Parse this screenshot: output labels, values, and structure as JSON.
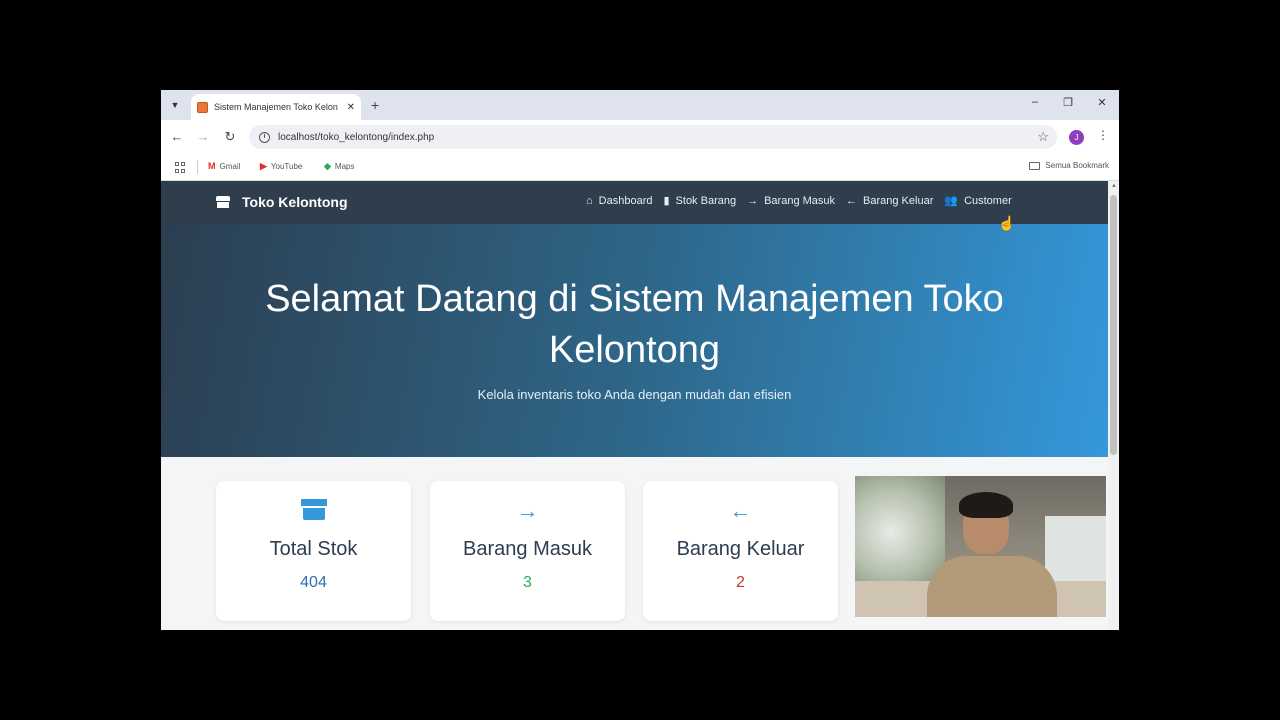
{
  "browser": {
    "tab_title": "Sistem Manajemen Toko Kelon",
    "url": "localhost/toko_kelontong/index.php",
    "profile_initial": "J",
    "bookmarks": [
      {
        "label": "Gmail",
        "icon": "gmail-icon",
        "icon_glyph": "M",
        "color": "#d93025"
      },
      {
        "label": "YouTube",
        "icon": "youtube-icon",
        "icon_glyph": "▶",
        "color": "#e52d27"
      },
      {
        "label": "Maps",
        "icon": "maps-icon",
        "icon_glyph": "◆",
        "color": "#34a853"
      }
    ],
    "all_bookmarks_label": "Semua Bookmark"
  },
  "navbar": {
    "brand": "Toko Kelontong",
    "links": [
      {
        "label": "Dashboard",
        "icon": "home-icon",
        "glyph": "⌂"
      },
      {
        "label": "Stok Barang",
        "icon": "box-icon",
        "glyph": "▮"
      },
      {
        "label": "Barang Masuk",
        "icon": "arrow-right-icon",
        "glyph": "→"
      },
      {
        "label": "Barang Keluar",
        "icon": "arrow-left-icon",
        "glyph": "←"
      },
      {
        "label": "Customer",
        "icon": "users-icon",
        "glyph": "👥"
      }
    ]
  },
  "hero": {
    "title": "Selamat Datang di Sistem Manajemen Toko Kelontong",
    "subtitle": "Kelola inventaris toko Anda dengan mudah dan efisien"
  },
  "cards": [
    {
      "title": "Total Stok",
      "value": "404",
      "icon": "box-open-icon",
      "value_color": "#2c6eb5"
    },
    {
      "title": "Barang Masuk",
      "value": "3",
      "icon": "arrow-right-icon",
      "glyph": "→",
      "value_color": "#27ae60"
    },
    {
      "title": "Barang Keluar",
      "value": "2",
      "icon": "arrow-left-icon",
      "glyph": "←",
      "value_color": "#c0392b"
    }
  ],
  "colors": {
    "navbar_bg": "#2f3e4c",
    "hero_gradient_start": "#2c3e50",
    "hero_gradient_end": "#3498db",
    "accent": "#3498db"
  }
}
